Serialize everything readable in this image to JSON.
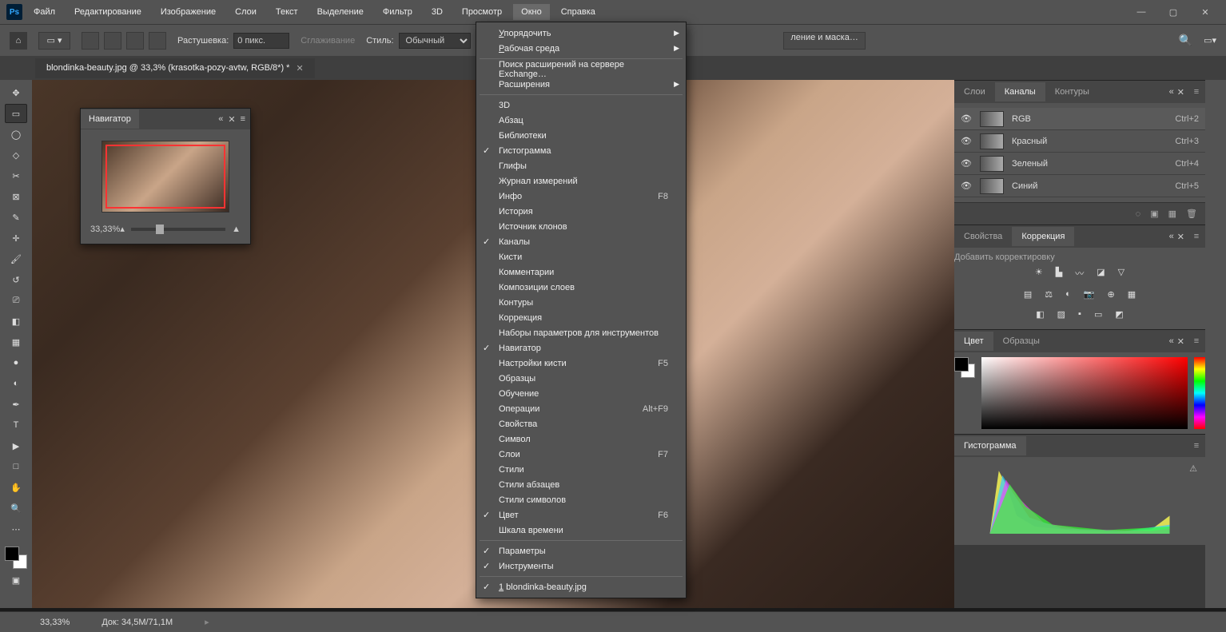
{
  "menubar": {
    "items": [
      "Файл",
      "Редактирование",
      "Изображение",
      "Слои",
      "Текст",
      "Выделение",
      "Фильтр",
      "3D",
      "Просмотр",
      "Окно",
      "Справка"
    ],
    "active_index": 9
  },
  "window_controls": {
    "min": "—",
    "max": "▢",
    "close": "✕"
  },
  "optionsbar": {
    "feather_label": "Растушевка:",
    "feather_value": "0 пикс.",
    "antialias": "Сглаживание",
    "style_label": "Стиль:",
    "style_value": "Обычный",
    "mask_btn": "ление и маска…"
  },
  "doc_tab": "blondinka-beauty.jpg @ 33,3% (krasotka-pozy-avtw, RGB/8*) *",
  "navigator": {
    "title": "Навигатор",
    "zoom": "33,33%"
  },
  "open_menu": {
    "groups": [
      [
        {
          "label": "Упорядочить",
          "sub": true,
          "ul": "У"
        },
        {
          "label": "Рабочая среда",
          "sub": true,
          "ul": "Р"
        }
      ],
      [
        {
          "label": "Поиск расширений на сервере Exchange…"
        },
        {
          "label": "Расширения",
          "sub": true
        }
      ],
      [
        {
          "label": "3D"
        },
        {
          "label": "Абзац"
        },
        {
          "label": "Библиотеки"
        },
        {
          "label": "Гистограмма",
          "check": true
        },
        {
          "label": "Глифы"
        },
        {
          "label": "Журнал измерений"
        },
        {
          "label": "Инфо",
          "shortcut": "F8"
        },
        {
          "label": "История"
        },
        {
          "label": "Источник клонов"
        },
        {
          "label": "Каналы",
          "check": true
        },
        {
          "label": "Кисти"
        },
        {
          "label": "Комментарии"
        },
        {
          "label": "Композиции слоев"
        },
        {
          "label": "Контуры"
        },
        {
          "label": "Коррекция"
        },
        {
          "label": "Наборы параметров для инструментов"
        },
        {
          "label": "Навигатор",
          "check": true
        },
        {
          "label": "Настройки кисти",
          "shortcut": "F5"
        },
        {
          "label": "Образцы"
        },
        {
          "label": "Обучение"
        },
        {
          "label": "Операции",
          "shortcut": "Alt+F9"
        },
        {
          "label": "Свойства"
        },
        {
          "label": "Символ"
        },
        {
          "label": "Слои",
          "shortcut": "F7"
        },
        {
          "label": "Стили"
        },
        {
          "label": "Стили абзацев"
        },
        {
          "label": "Стили символов"
        },
        {
          "label": "Цвет",
          "shortcut": "F6",
          "check": true
        },
        {
          "label": "Шкала времени"
        }
      ],
      [
        {
          "label": "Параметры",
          "check": true
        },
        {
          "label": "Инструменты",
          "check": true
        }
      ],
      [
        {
          "label": "1 blondinka-beauty.jpg",
          "check": true,
          "ul": "1"
        }
      ]
    ]
  },
  "tools": [
    "move",
    "marquee",
    "lasso",
    "magic-lasso",
    "crop",
    "frame",
    "eyedropper",
    "healing",
    "brush",
    "history-brush",
    "stamp",
    "eraser",
    "gradient",
    "blur",
    "dodge",
    "pen",
    "type",
    "path-select",
    "rectangle",
    "hand",
    "zoom"
  ],
  "channels_panel": {
    "tabs": [
      "Слои",
      "Каналы",
      "Контуры"
    ],
    "active": 1,
    "rows": [
      {
        "name": "RGB",
        "shortcut": "Ctrl+2",
        "active": true
      },
      {
        "name": "Красный",
        "shortcut": "Ctrl+3"
      },
      {
        "name": "Зеленый",
        "shortcut": "Ctrl+4"
      },
      {
        "name": "Синий",
        "shortcut": "Ctrl+5"
      }
    ]
  },
  "props_panel": {
    "tabs": [
      "Свойства",
      "Коррекция"
    ],
    "active": 1,
    "add_label": "Добавить корректировку"
  },
  "color_panel": {
    "tabs": [
      "Цвет",
      "Образцы"
    ],
    "active": 0
  },
  "histo_panel": {
    "title": "Гистограмма"
  },
  "statusbar": {
    "zoom": "33,33%",
    "doc": "Док: 34,5M/71,1M"
  }
}
